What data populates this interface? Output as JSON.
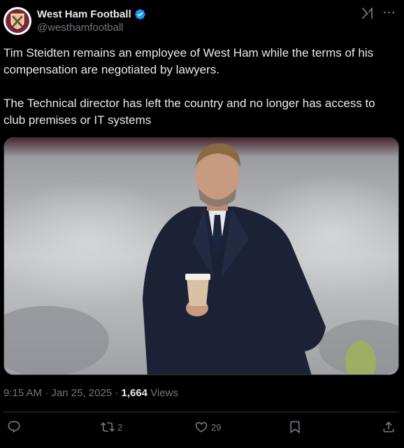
{
  "author": {
    "display_name": "West Ham Football",
    "handle": "@westhamfootball",
    "verified": true,
    "avatar_icon": "west-ham-crest-icon"
  },
  "header_icons": [
    "grok-icon",
    "more-icon"
  ],
  "tweet": {
    "paragraphs": [
      "Tim Steidten remains an employee of West Ham while the terms of his compensation are negotiated by lawyers.",
      "The Technical director has left the country and no longer has access to club premises or IT systems"
    ],
    "media_icon": "photo"
  },
  "meta": {
    "time": "9:15 AM",
    "separator": "·",
    "date": "Jan 25, 2025",
    "views_count": "1,664",
    "views_label": "Views"
  },
  "actions": {
    "reply_count": "",
    "retweet_count": "2",
    "like_count": "29"
  },
  "colors": {
    "background": "#000000",
    "text": "#e7e9ea",
    "muted": "#71767b",
    "verified": "#1d9bf0",
    "border": "#2f3336",
    "claret": "#7a263a"
  }
}
